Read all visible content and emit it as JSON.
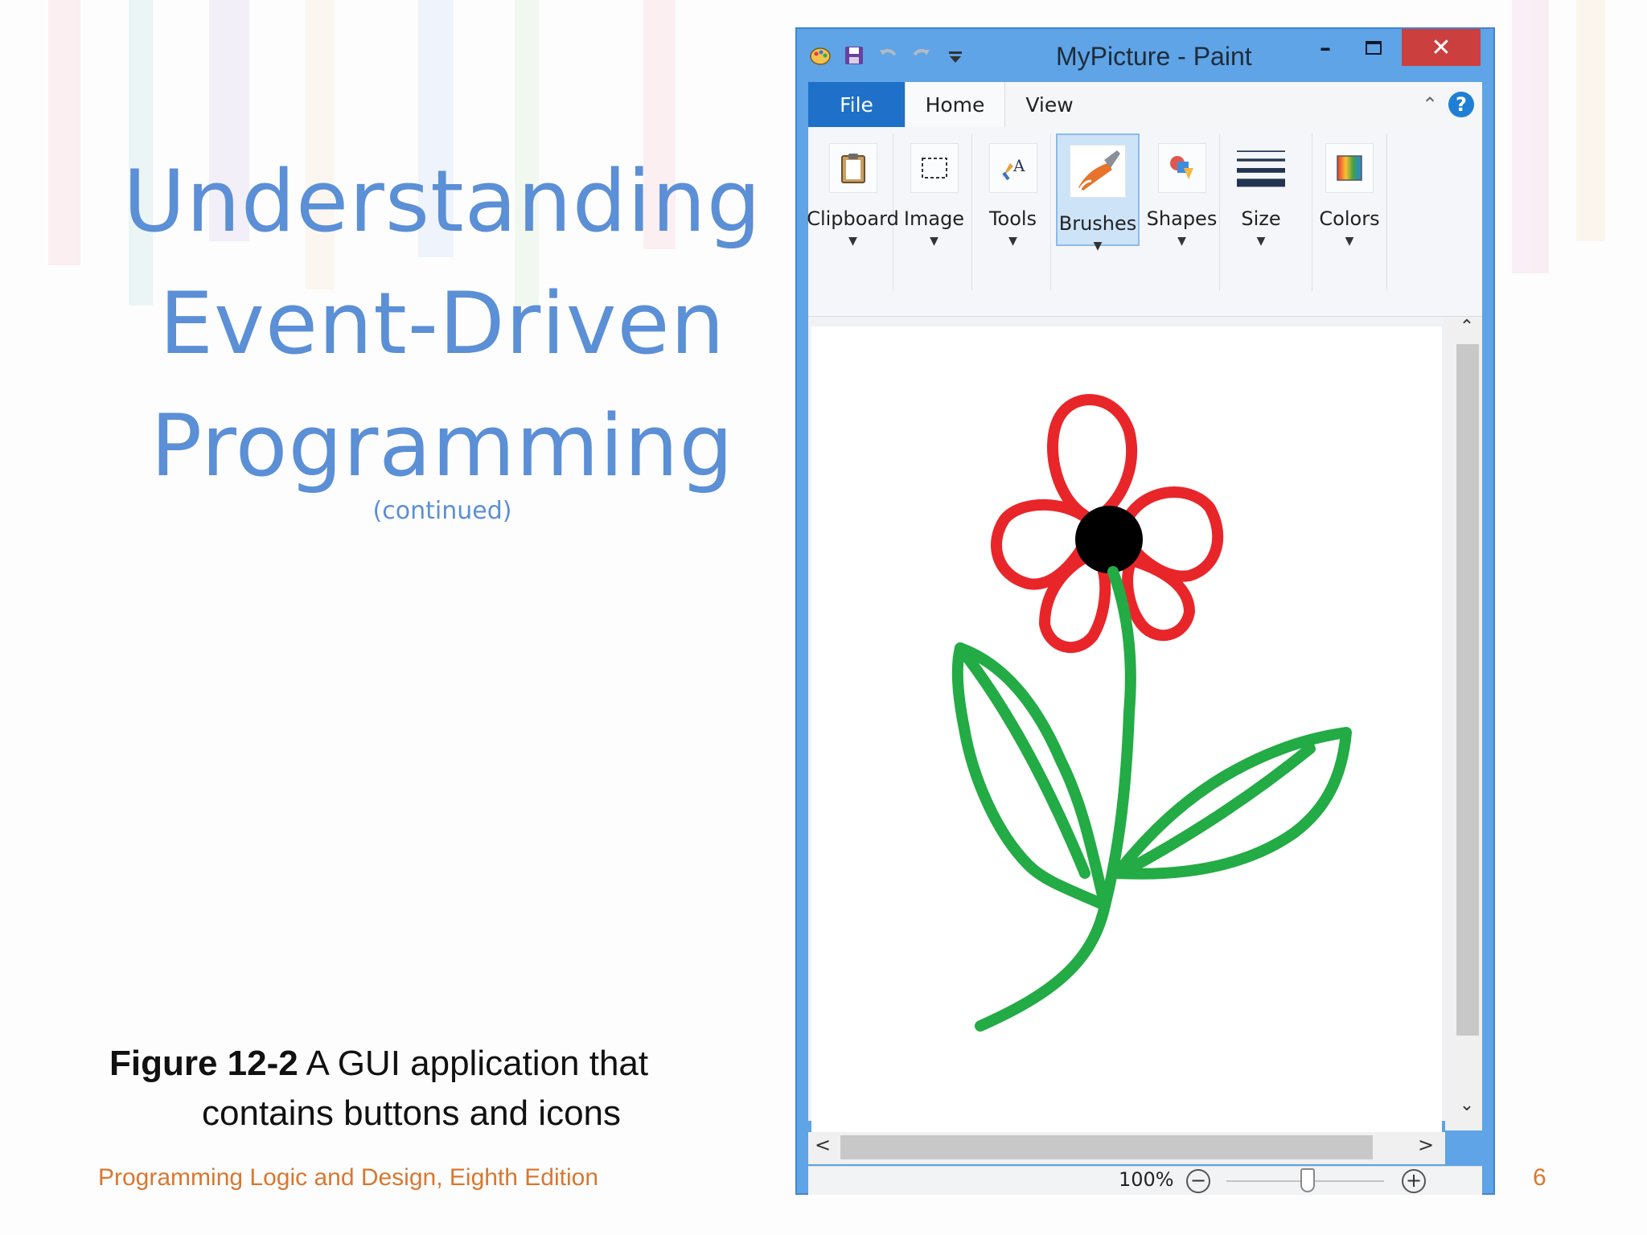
{
  "slide": {
    "title_lines": [
      "Understanding",
      "Event-Driven",
      "Programming"
    ],
    "subtitle": "(continued)",
    "caption_bold": "Figure 12-2",
    "caption_text_1": " A GUI application that",
    "caption_text_2": "contains buttons and icons",
    "footer": "Programming Logic and Design, Eighth Edition",
    "page_number": "6"
  },
  "paint": {
    "window_title": "MyPicture - Paint",
    "close_glyph": "✕",
    "min_glyph": "–",
    "menu": {
      "file": "File",
      "home": "Home",
      "view": "View",
      "help_glyph": "?",
      "collapse_glyph": "⌃"
    },
    "ribbon_groups": [
      {
        "label": "Clipboard",
        "icon": "clipboard-icon"
      },
      {
        "label": "Image",
        "icon": "select-icon"
      },
      {
        "label": "Tools",
        "icon": "tools-icon"
      },
      {
        "label": "Brushes",
        "icon": "brush-icon",
        "selected": true
      },
      {
        "label": "Shapes",
        "icon": "shapes-icon"
      },
      {
        "label": "Size",
        "icon": "size-icon"
      },
      {
        "label": "Colors",
        "icon": "colors-icon"
      }
    ],
    "dropdown_glyph": "▼",
    "scroll": {
      "up": "⌃",
      "down": "⌄",
      "left": "<",
      "right": ">"
    },
    "status": {
      "zoom": "100%",
      "zoom_out": "−",
      "zoom_in": "+"
    },
    "drawing_colors": {
      "petals": "#e8262a",
      "center": "#000000",
      "stem": "#23ab45"
    }
  }
}
